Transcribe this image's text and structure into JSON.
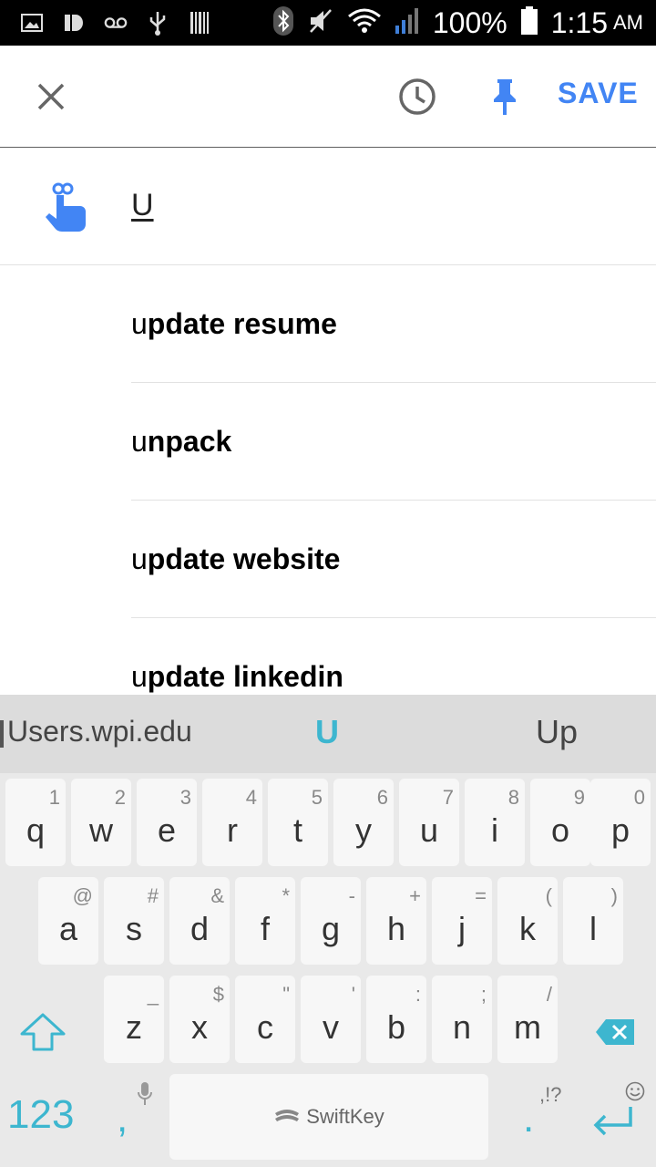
{
  "status_bar": {
    "battery": "100%",
    "time": "1:15",
    "ampm": "AM",
    "icons": [
      "image-icon",
      "pandora-icon",
      "voicemail-icon",
      "usb-icon",
      "barcode-icon",
      "bluetooth-icon",
      "mute-icon",
      "wifi-icon",
      "signal-icon",
      "battery-icon"
    ]
  },
  "app_bar": {
    "close_icon": "close-icon",
    "history_icon": "history-icon",
    "pin_icon": "pin-icon",
    "save_label": "SAVE",
    "accent_color": "#4285f4"
  },
  "reminder": {
    "icon": "hand-reminder-icon",
    "input_value": "U"
  },
  "suggestions": [
    {
      "prefix": "u",
      "rest": "pdate resume"
    },
    {
      "prefix": "u",
      "rest": "npack"
    },
    {
      "prefix": "u",
      "rest": "pdate website"
    },
    {
      "prefix": "u",
      "rest": "pdate linkedin"
    }
  ],
  "keyboard": {
    "predictions": {
      "left": "Users.wpi.edu",
      "middle": "U",
      "right": "Up"
    },
    "row1": [
      {
        "main": "q",
        "sub": "1"
      },
      {
        "main": "w",
        "sub": "2"
      },
      {
        "main": "e",
        "sub": "3"
      },
      {
        "main": "r",
        "sub": "4"
      },
      {
        "main": "t",
        "sub": "5"
      },
      {
        "main": "y",
        "sub": "6"
      },
      {
        "main": "u",
        "sub": "7"
      },
      {
        "main": "i",
        "sub": "8"
      },
      {
        "main": "o",
        "sub": "9"
      },
      {
        "main": "p",
        "sub": "0"
      }
    ],
    "row2": [
      {
        "main": "a",
        "sub": "@"
      },
      {
        "main": "s",
        "sub": "#"
      },
      {
        "main": "d",
        "sub": "&"
      },
      {
        "main": "f",
        "sub": "*"
      },
      {
        "main": "g",
        "sub": "-"
      },
      {
        "main": "h",
        "sub": "+"
      },
      {
        "main": "j",
        "sub": "="
      },
      {
        "main": "k",
        "sub": "("
      },
      {
        "main": "l",
        "sub": ")"
      }
    ],
    "row3": [
      {
        "main": "z",
        "sub": "_"
      },
      {
        "main": "x",
        "sub": "$"
      },
      {
        "main": "c",
        "sub": "\""
      },
      {
        "main": "v",
        "sub": "'"
      },
      {
        "main": "b",
        "sub": ":"
      },
      {
        "main": "n",
        "sub": ";"
      },
      {
        "main": "m",
        "sub": "/"
      }
    ],
    "num_label": "123",
    "comma": ",",
    "period": ".",
    "punctuation_hint": ",!?",
    "space_brand": "SwiftKey",
    "accent_color": "#3db6cf"
  }
}
